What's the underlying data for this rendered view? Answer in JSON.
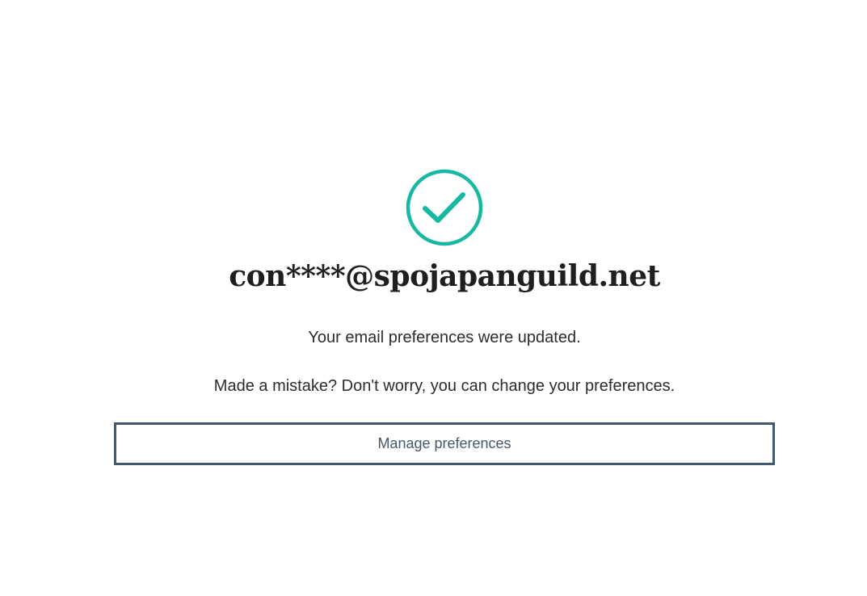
{
  "confirmation": {
    "icon": "check-circle-icon",
    "accent_color": "#17b8a2",
    "email": "con****@spojapanguild.net",
    "updated_message": "Your email preferences were updated.",
    "mistake_message": "Made a mistake? Don't worry, you can change your preferences."
  },
  "actions": {
    "manage_label": "Manage preferences",
    "button_color": "#44586d"
  }
}
